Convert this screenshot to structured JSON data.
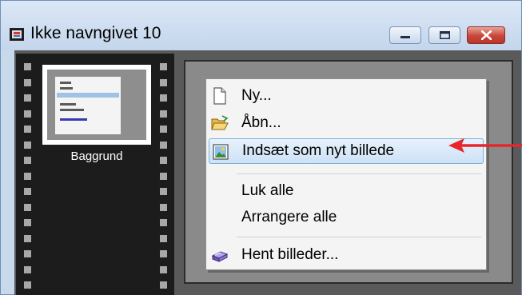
{
  "window": {
    "title": "Ikke navngivet 10",
    "controls": [
      "minimize-icon",
      "maximize-icon",
      "close-icon"
    ]
  },
  "filmstrip": {
    "thumbnail_label": "Baggrund"
  },
  "context_menu": {
    "items": [
      {
        "label": "Ny...",
        "icon": "new-document-icon"
      },
      {
        "label": "Åbn...",
        "icon": "open-folder-icon"
      },
      {
        "label": "Indsæt som nyt billede",
        "icon": "paste-image-icon",
        "highlighted": true
      },
      {
        "label": "Luk alle"
      },
      {
        "label": "Arrangere alle"
      },
      {
        "label": "Hent billeder...",
        "icon": "scanner-icon"
      }
    ]
  },
  "annotation": {
    "arrow_color": "#e8262a",
    "points_to": "Indsæt som nyt billede"
  },
  "colors": {
    "highlight_border": "#7eb0dd",
    "close_button": "#c9453a",
    "filmstrip": "#1c1c1c"
  }
}
